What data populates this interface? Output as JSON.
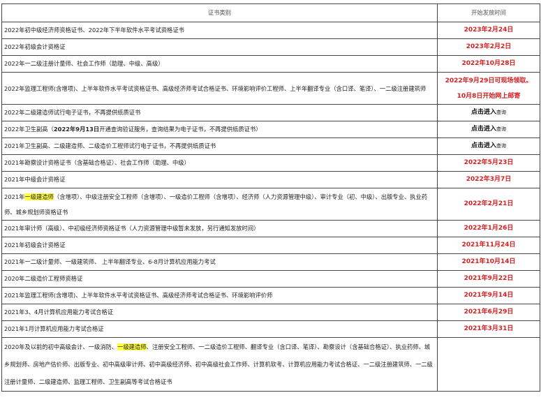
{
  "header": {
    "col1": "证书类别",
    "col2": "开始发放时间"
  },
  "rows": [
    {
      "text": "2022年初中级经济师资格证书、2022年下半年软件水平考试资格证书",
      "date": "2023年2月24日"
    },
    {
      "text": "2022年初级会计资格证",
      "date": "2023年2月2日"
    },
    {
      "text": "2022年一二级注册计量师、社会工作师（助理、中级、高级）",
      "date": "2022年10月28日"
    },
    {
      "text": "2022年监理工程师(含增项)、上半年软件水平考试资格证书、高级经济师考试合格证书、环境影响评价工程师、上半年翻译专业（含口译、笔译）、一二级注册建筑师",
      "date": "2022年9月29日可现场领取。",
      "date_line2": "10月8日开始网上邮寄"
    },
    {
      "text": "2022年二级建造师试行电子证书，不再提供纸质证书",
      "date": "点击进入",
      "date_suffix": "查询"
    },
    {
      "text_pre": "2022年卫生副高（",
      "text_bold": "2022年9月13日",
      "text_post": "开通查询验证服务，查询结果为电子证书，不再提供纸质证书）",
      "date": "点击进入",
      "date_suffix": "查询"
    },
    {
      "text": "2021年卫生副高、二级建造师、二级造价工程师试行电子证书，不再提供纸质证书",
      "date": "点击进入",
      "date_suffix": "查询"
    },
    {
      "text": "2021年勘察设计资格证书（含基础合格证）、社会工作师（助理、中级）",
      "date": "2022年5月23日"
    },
    {
      "text": "2021年中级会计资格证",
      "date": "2022年3月7日"
    },
    {
      "text_pre": "2021年",
      "text_hl": "一级建造师",
      "text_post": "（含增项）、中级注册安全工程师（含增项）、一级造价工程师（含增项）、经济师（人力资源管理中级）、审计专业（初、中级）、出版专业、执业药师、城乡规划师资格证书",
      "date": "2022年2月21日"
    },
    {
      "text": "2021年审计师（高级）、中初级经济师资格证书（人力资源管理中级暂未发放，另行通知发放时间）",
      "date": "2022年1月26日"
    },
    {
      "text": "2021年初级会计资格证",
      "date": "2021年11月24日"
    },
    {
      "text": "2021年一二级计量师、一级建筑师、 上半年翻译专业、6-8月计算机应用能力考试",
      "date": "2021年10月14日"
    },
    {
      "text": "2020年二级造价工程师资格证",
      "date": "2021年9月22日"
    },
    {
      "text": "2021年监理工程师(含增项)、上半年软件水平考试资格证书、高级经济师考试合格证书、环境影响评价师",
      "date": "2021年9月14日"
    },
    {
      "text": "2021年3、4月计算机应用能力考试合格证",
      "date": "2021年6月29日"
    },
    {
      "text": "2021年1月计算机应用能力考试合格证",
      "date": "2021年3月31日"
    },
    {
      "text_pre": "2020年及以前的初中高级会计、一级消防、",
      "text_hl": "一级建造师",
      "text_post": "、注册安全工程师、一二级造价工程师、翻译专业（含口译、笔译）、勘察设计（含基础合格证）、执业药师、城乡规划师、房地产估价师、出版专业、初中高级审计师、初中高级经济师、初中高级社会工作师、计算机软考、计算机应用能力考试合格证、一二级注册建筑师、一二级注册计量师、二级建造师、监理工程师、卫生副高等考试合格证书",
      "date": ""
    }
  ],
  "colors": {
    "date_red": "#d42020",
    "highlight": "#ffff44",
    "border": "#444444"
  }
}
